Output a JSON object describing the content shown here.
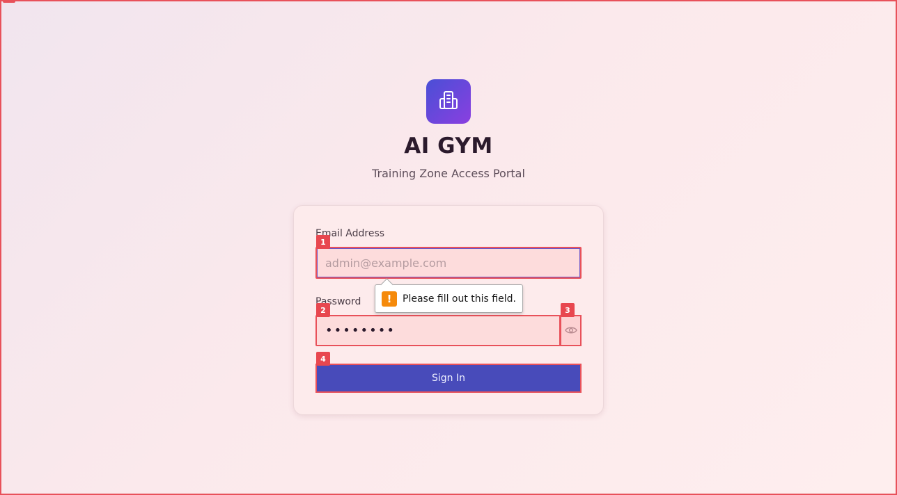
{
  "brand": {
    "logo_icon": "building-icon",
    "title": "AI GYM",
    "subtitle": "Training Zone Access Portal"
  },
  "form": {
    "email_label": "Email Address",
    "email_placeholder": "admin@example.com",
    "email_value": "",
    "password_label": "Password",
    "password_value": "••••••••",
    "toggle_icon": "eye-icon",
    "submit_label": "Sign In"
  },
  "validation": {
    "message": "Please fill out this field.",
    "icon": "warning-icon"
  },
  "markers": [
    "1",
    "2",
    "3",
    "4"
  ],
  "colors": {
    "accent": "#484bba",
    "highlight": "#e8515a",
    "warning": "#f58a0b"
  }
}
